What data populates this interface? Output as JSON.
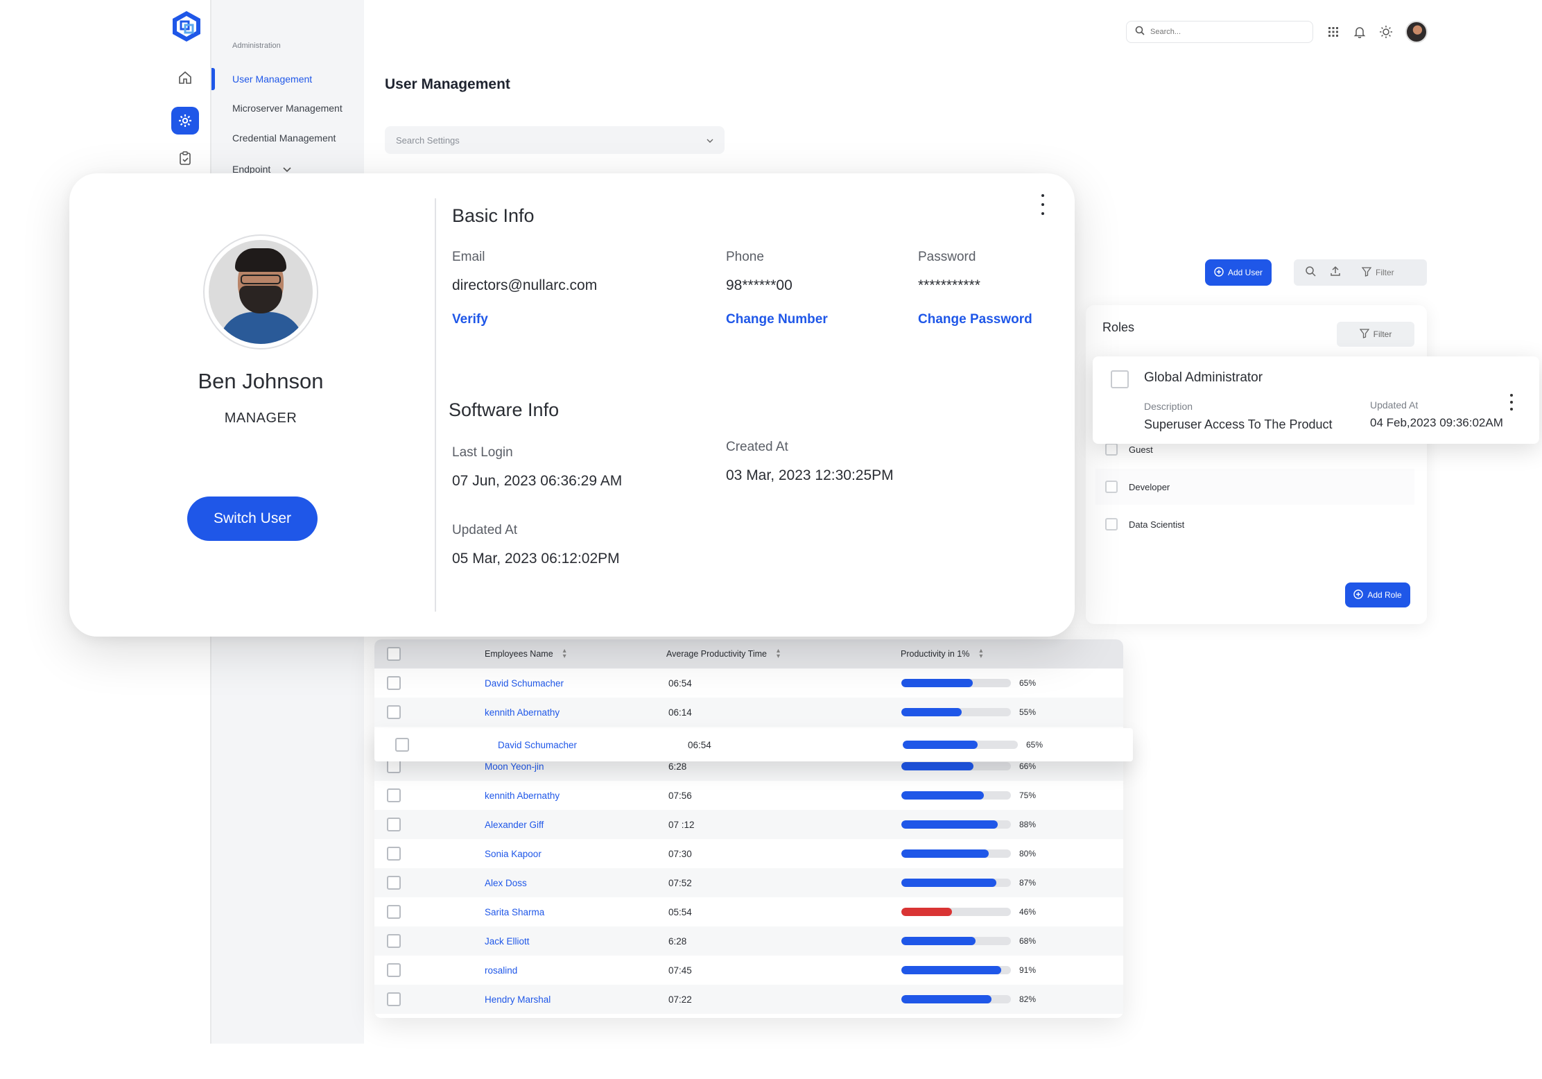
{
  "colors": {
    "accent": "#1f57e8",
    "danger": "#d93434",
    "bar_track": "#e2e3e6"
  },
  "rail": {
    "logo_icon": "hexagon-logo-icon",
    "icons": [
      "home-icon",
      "settings-gear-icon",
      "clipboard-check-icon"
    ]
  },
  "submenu": {
    "heading": "Administration",
    "items": [
      {
        "label": "User Management",
        "active": true
      },
      {
        "label": "Microserver Management"
      },
      {
        "label": "Credential Management"
      },
      {
        "label": "Endpoint"
      }
    ]
  },
  "topbar": {
    "search_placeholder": "Search...",
    "icons": [
      "apps-grid-icon",
      "bell-icon",
      "sun-icon",
      "avatar"
    ]
  },
  "page": {
    "title": "User Management",
    "settings_search_placeholder": "Search Settings"
  },
  "profile": {
    "name": "Ben Johnson",
    "role": "MANAGER",
    "switch_label": "Switch User",
    "basic_info": {
      "title": "Basic Info",
      "email_label": "Email",
      "email": "directors@nullarc.com",
      "email_action": "Verify",
      "phone_label": "Phone",
      "phone": "98******00",
      "phone_action": "Change Number",
      "password_label": "Password",
      "password": "***********",
      "password_action": "Change Password"
    },
    "software_info": {
      "title": "Software Info",
      "last_login_label": "Last Login",
      "last_login": "07 Jun, 2023 06:36:29 AM",
      "created_label": "Created At",
      "created": "03 Mar, 2023 12:30:25PM",
      "updated_label": "Updated At",
      "updated": "05 Mar, 2023 06:12:02PM"
    }
  },
  "toolbar": {
    "add_user": "Add User",
    "filter": "Filter"
  },
  "roles": {
    "title": "Roles",
    "filter": "Filter",
    "items": [
      "Guest",
      "Developer",
      "Data Scientist"
    ],
    "add_role": "Add Role",
    "popup": {
      "title": "Global Administrator",
      "description_label": "Description",
      "description": "Superuser Access To The Product",
      "updated_label": "Updated At",
      "updated": "04 Feb,2023 09:36:02AM"
    }
  },
  "table": {
    "headers": [
      "Employees Name",
      "Average Productivity Time",
      "Productivity in 1%"
    ],
    "rows": [
      {
        "name": "David Schumacher",
        "time": "06:54",
        "pct": "65%",
        "value": 65
      },
      {
        "name": "kennith Abernathy",
        "time": "06:14",
        "pct": "55%",
        "value": 55
      },
      {
        "name": "David Schumacher",
        "time": "06:54",
        "pct": "65%",
        "value": 65,
        "floating": true
      },
      {
        "name": "Moon Yeon-jin",
        "time": "6:28",
        "pct": "66%",
        "value": 66
      },
      {
        "name": "kennith Abernathy",
        "time": "07:56",
        "pct": "75%",
        "value": 75
      },
      {
        "name": "Alexander Giff",
        "time": "07 :12",
        "pct": "88%",
        "value": 88
      },
      {
        "name": "Sonia Kapoor",
        "time": "07:30",
        "pct": "80%",
        "value": 80
      },
      {
        "name": "Alex Doss",
        "time": "07:52",
        "pct": "87%",
        "value": 87
      },
      {
        "name": "Sarita Sharma",
        "time": "05:54",
        "pct": "46%",
        "value": 46,
        "low": true
      },
      {
        "name": "Jack Elliott",
        "time": "6:28",
        "pct": "68%",
        "value": 68
      },
      {
        "name": "rosalind",
        "time": "07:45",
        "pct": "91%",
        "value": 91
      },
      {
        "name": "Hendry Marshal",
        "time": "07:22",
        "pct": "82%",
        "value": 82
      }
    ]
  }
}
